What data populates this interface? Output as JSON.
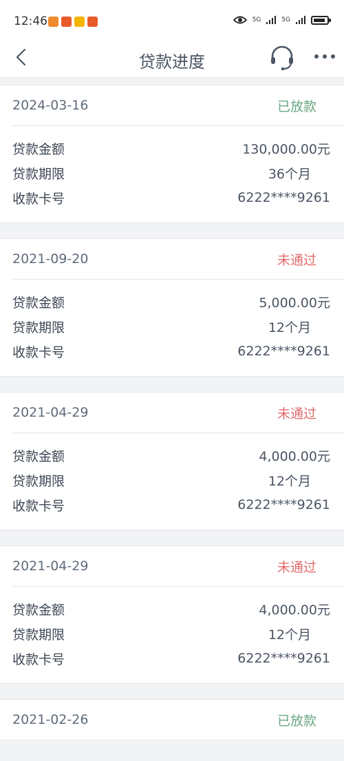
{
  "statusbar": {
    "time": "12:46",
    "network1": "5G",
    "network2": "5G",
    "colors": [
      "#f08a2e",
      "#e85a2a",
      "#f5b400",
      "#e85a2a"
    ]
  },
  "navbar": {
    "title": "贷款进度",
    "back_icon": "chevron-left-icon",
    "support_icon": "headset-icon",
    "more_icon": "more-dots-icon"
  },
  "labels": {
    "amount": "贷款金额",
    "term": "贷款期限",
    "card": "收款卡号"
  },
  "loans": [
    {
      "date": "2024-03-16",
      "status": "已放款",
      "status_type": "approved",
      "amount": "130,000.00元",
      "term": "36个月",
      "card": "6222****9261"
    },
    {
      "date": "2021-09-20",
      "status": "未通过",
      "status_type": "rejected",
      "amount": "5,000.00元",
      "term": "12个月",
      "card": "6222****9261"
    },
    {
      "date": "2021-04-29",
      "status": "未通过",
      "status_type": "rejected",
      "amount": "4,000.00元",
      "term": "12个月",
      "card": "6222****9261"
    },
    {
      "date": "2021-04-29",
      "status": "未通过",
      "status_type": "rejected",
      "amount": "4,000.00元",
      "term": "12个月",
      "card": "6222****9261"
    },
    {
      "date": "2021-02-26",
      "status": "已放款",
      "status_type": "approved"
    }
  ],
  "colors": {
    "approved": "#6aa782",
    "rejected": "#e26b6b"
  }
}
